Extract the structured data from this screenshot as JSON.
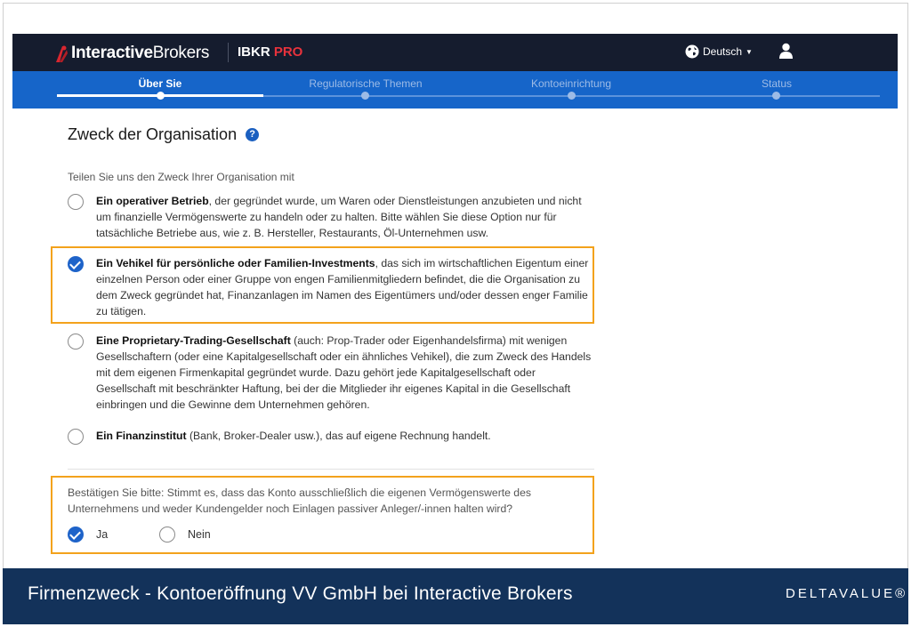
{
  "header": {
    "brand_bold": "Interactive",
    "brand_regular": "Brokers",
    "product_main": "IBKR",
    "product_accent": "PRO",
    "language": "Deutsch",
    "icons": [
      "globe-icon",
      "user-icon",
      "ib-logo-mark"
    ]
  },
  "steps": {
    "items": [
      {
        "label": "Über Sie",
        "active": true
      },
      {
        "label": "Regulatorische Themen",
        "active": false
      },
      {
        "label": "Kontoeinrichtung",
        "active": false
      },
      {
        "label": "Status",
        "active": false
      }
    ]
  },
  "form": {
    "title": "Zweck der Organisation",
    "help_glyph": "?",
    "prompt": "Teilen Sie uns den Zweck Ihrer Organisation mit",
    "options": [
      {
        "bold": "Ein operativer Betrieb",
        "text": ", der gegründet wurde, um Waren oder Dienstleistungen anzubieten und nicht um finanzielle Vermögenswerte zu handeln oder zu halten. Bitte wählen Sie diese Option nur für tatsächliche Betriebe aus, wie z. B. Hersteller, Restaurants, Öl-Unternehmen usw.",
        "selected": false
      },
      {
        "bold": "Ein Vehikel für persönliche oder Familien-Investments",
        "text": ", das sich im wirtschaftlichen Eigentum einer einzelnen Person oder einer Gruppe von engen Familienmitgliedern befindet, die die Organisation zu dem Zweck gegründet hat, Finanzanlagen im Namen des Eigentümers und/oder dessen enger Familie zu tätigen.",
        "selected": true
      },
      {
        "bold": "Eine Proprietary-Trading-Gesellschaft",
        "text": " (auch: Prop-Trader oder Eigenhandelsfirma) mit wenigen Gesellschaftern (oder eine Kapitalgesellschaft oder ein ähnliches Vehikel), die zum Zweck des Handels mit dem eigenen Firmenkapital gegründet wurde. Dazu gehört jede Kapitalgesellschaft oder Gesellschaft mit beschränkter Haftung, bei der die Mitglieder ihr eigenes Kapital in die Gesellschaft einbringen und die Gewinne dem Unternehmen gehören.",
        "selected": false
      },
      {
        "bold": "Ein Finanzinstitut",
        "text": " (Bank, Broker-Dealer usw.), das auf eigene Rechnung handelt.",
        "selected": false
      }
    ],
    "confirm_question": "Bestätigen Sie bitte: Stimmt es, dass das Konto ausschließlich die eigenen Vermögenswerte des Unternehmens und weder Kundengelder noch Einlagen passiver Anleger/-innen halten wird?",
    "yes_label": "Ja",
    "no_label": "Nein",
    "confirm_selected": "Ja"
  },
  "footer": {
    "title": "Firmenzweck - Kontoeröffnung VV GmbH bei Interactive Brokers",
    "logo_text": "DELTAVALUE®"
  },
  "colors": {
    "header_bg": "#151c2e",
    "stepbar_bg": "#1665c9",
    "accent_red": "#e8323c",
    "radio_checked": "#1e63c9",
    "highlight_border": "#f3a21c",
    "footer_bg": "#13325a"
  }
}
